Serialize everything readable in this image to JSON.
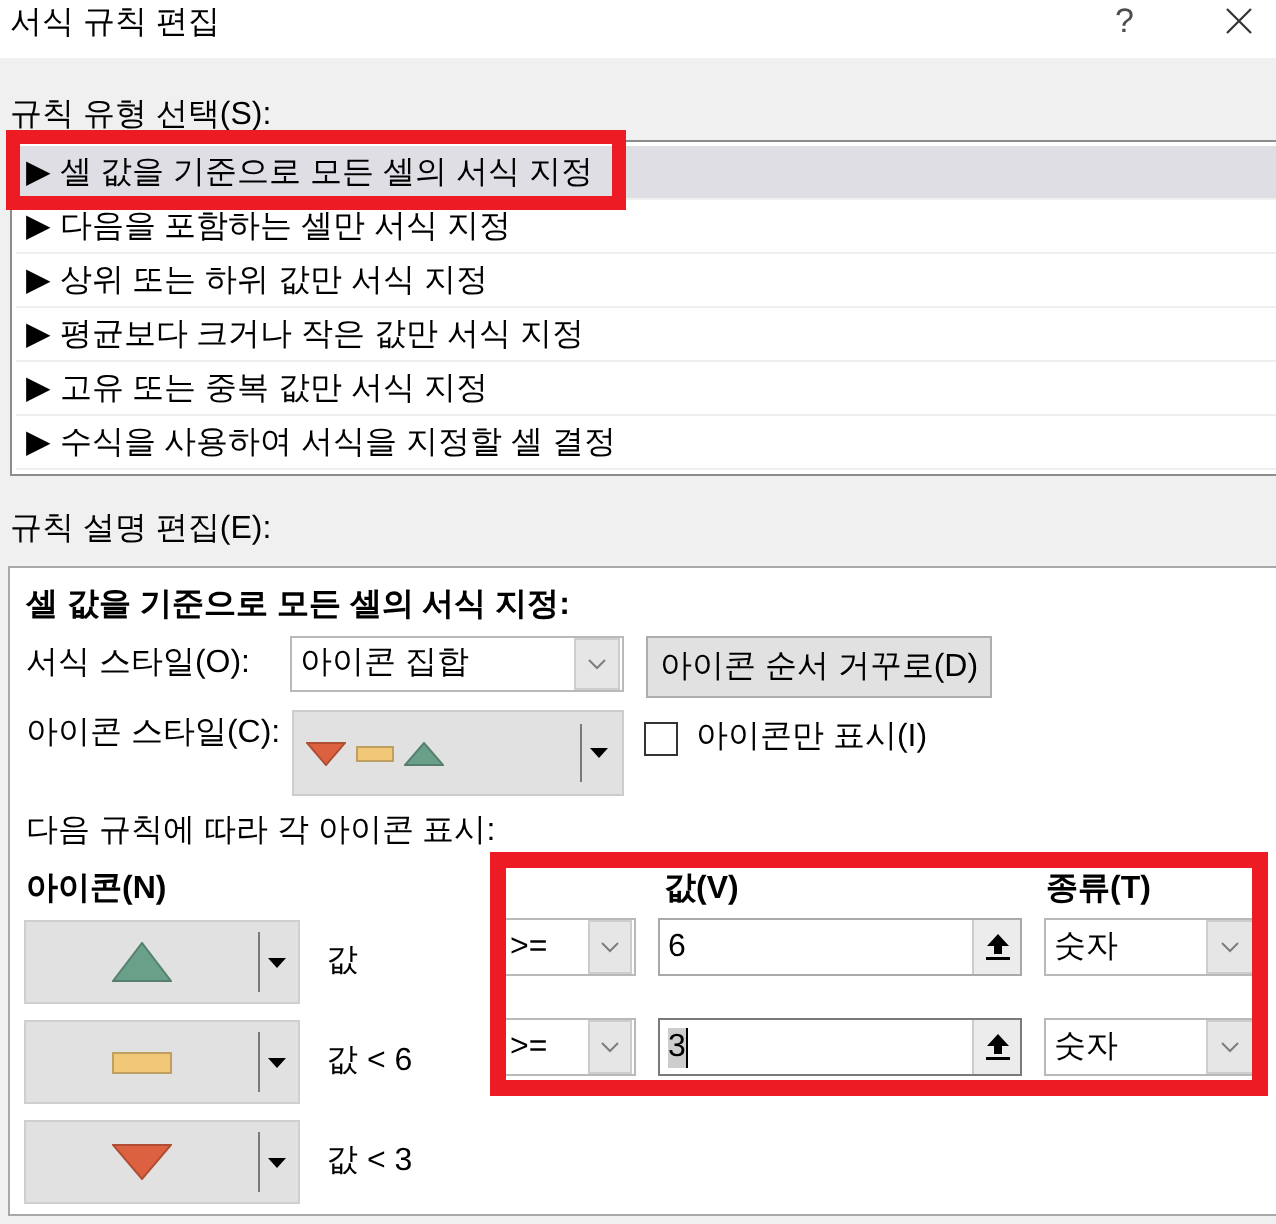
{
  "window": {
    "title": "서식 규칙 편집",
    "help": "?"
  },
  "rule_type_label": "규칙 유형 선택(S):",
  "rule_types": [
    {
      "label": "▶ 셀 값을 기준으로 모든 셀의 서식 지정",
      "selected": true,
      "highlighted": true
    },
    {
      "label": "▶ 다음을 포함하는 셀만 서식 지정",
      "selected": false,
      "highlighted": false
    },
    {
      "label": "▶ 상위 또는 하위 값만 서식 지정",
      "selected": false,
      "highlighted": false
    },
    {
      "label": "▶ 평균보다 크거나 작은 값만 서식 지정",
      "selected": false,
      "highlighted": false
    },
    {
      "label": "▶ 고유 또는 중복 값만 서식 지정",
      "selected": false,
      "highlighted": false
    },
    {
      "label": "▶ 수식을 사용하여 서식을 지정할 셀 결정",
      "selected": false,
      "highlighted": false
    }
  ],
  "description_label": "규칙 설명 편집(E):",
  "editor": {
    "title": "셀 값을 기준으로 모든 셀의 서식 지정:",
    "format_style": {
      "label": "서식 스타일(O):",
      "value": "아이콘 집합"
    },
    "reverse_button": "아이콘 순서 거꾸로(D)",
    "icon_style": {
      "label": "아이콘 스타일(C):",
      "icons": [
        {
          "kind": "triangle-down",
          "color": "#dc6140"
        },
        {
          "kind": "bar",
          "color": "#f0c878"
        },
        {
          "kind": "triangle-up",
          "color": "#6aa08a"
        }
      ]
    },
    "icon_only": {
      "label": "아이콘만 표시(I)",
      "checked": false
    },
    "rules_caption": "다음 규칙에 따라 각 아이콘 표시:",
    "columns": {
      "icon": "아이콘(N)",
      "value": "값(V)",
      "type": "종류(T)"
    },
    "conditions_highlighted": true,
    "rules": [
      {
        "icon": {
          "kind": "triangle-up",
          "color": "#6aa08a"
        },
        "condition": "값",
        "operator": ">=",
        "value": "6",
        "type": "숫자",
        "focused": false
      },
      {
        "icon": {
          "kind": "bar",
          "color": "#f0c878"
        },
        "condition": "값 < 6",
        "operator": ">=",
        "value": "3",
        "type": "숫자",
        "focused": true
      },
      {
        "icon": {
          "kind": "triangle-down",
          "color": "#dc6140"
        },
        "condition": "값 < 3"
      }
    ]
  }
}
